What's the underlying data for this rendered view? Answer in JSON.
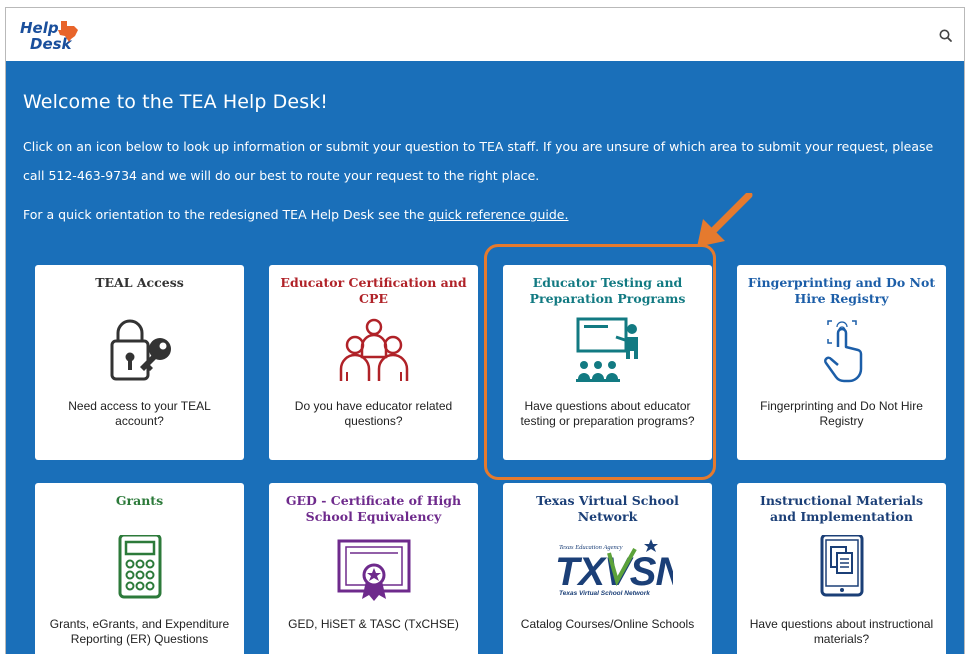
{
  "header": {
    "logo_line1": "Help",
    "logo_line2": "Desk"
  },
  "hero": {
    "welcome": "Welcome to the TEA Help Desk!",
    "intro": "Click on an icon below to look up information or submit your question to TEA staff. If you are unsure of which area to submit your request, please call 512-463-9734 and we will do our best to route your request to the right place.",
    "quick_prefix": "For a quick orientation to the redesigned TEA Help Desk see the ",
    "quick_link": "quick reference guide."
  },
  "cards": [
    {
      "title": "TEAL Access",
      "desc": "Need access to your TEAL account?",
      "icon": "lock-key-icon",
      "color": "#333333"
    },
    {
      "title": "Educator Certification and CPE",
      "desc": "Do you have educator related questions?",
      "icon": "educators-icon",
      "color": "#b02228"
    },
    {
      "title": "Educator Testing and Preparation Programs",
      "desc": "Have questions about educator testing or preparation programs?",
      "icon": "classroom-icon",
      "color": "#127a82"
    },
    {
      "title": "Fingerprinting and Do Not Hire Registry",
      "desc": "Fingerprinting and Do Not Hire Registry",
      "icon": "fingerprint-touch-icon",
      "color": "#1c5ea8"
    },
    {
      "title": "Grants",
      "desc": "Grants, eGrants, and Expenditure Reporting (ER) Questions",
      "icon": "calculator-icon",
      "color": "#2c7a3a"
    },
    {
      "title": "GED - Certificate of High School Equivalency",
      "desc": "GED, HiSET & TASC (TxCHSE)",
      "icon": "certificate-icon",
      "color": "#6e2a8c"
    },
    {
      "title": "Texas Virtual School Network",
      "desc": "Catalog Courses/Online Schools",
      "icon": "txvsn-logo",
      "color": "#1b3f77",
      "logo_small": "Texas Education Agency",
      "logo_main": "TXVSN",
      "logo_sub": "Texas Virtual School Network"
    },
    {
      "title": "Instructional Materials and Implementation",
      "desc": "Have questions about instructional materials?",
      "icon": "tablet-document-icon",
      "color": "#1b3f77"
    }
  ],
  "colors": {
    "hero_bg": "#1a6fb9",
    "highlight": "#e57a2e"
  }
}
